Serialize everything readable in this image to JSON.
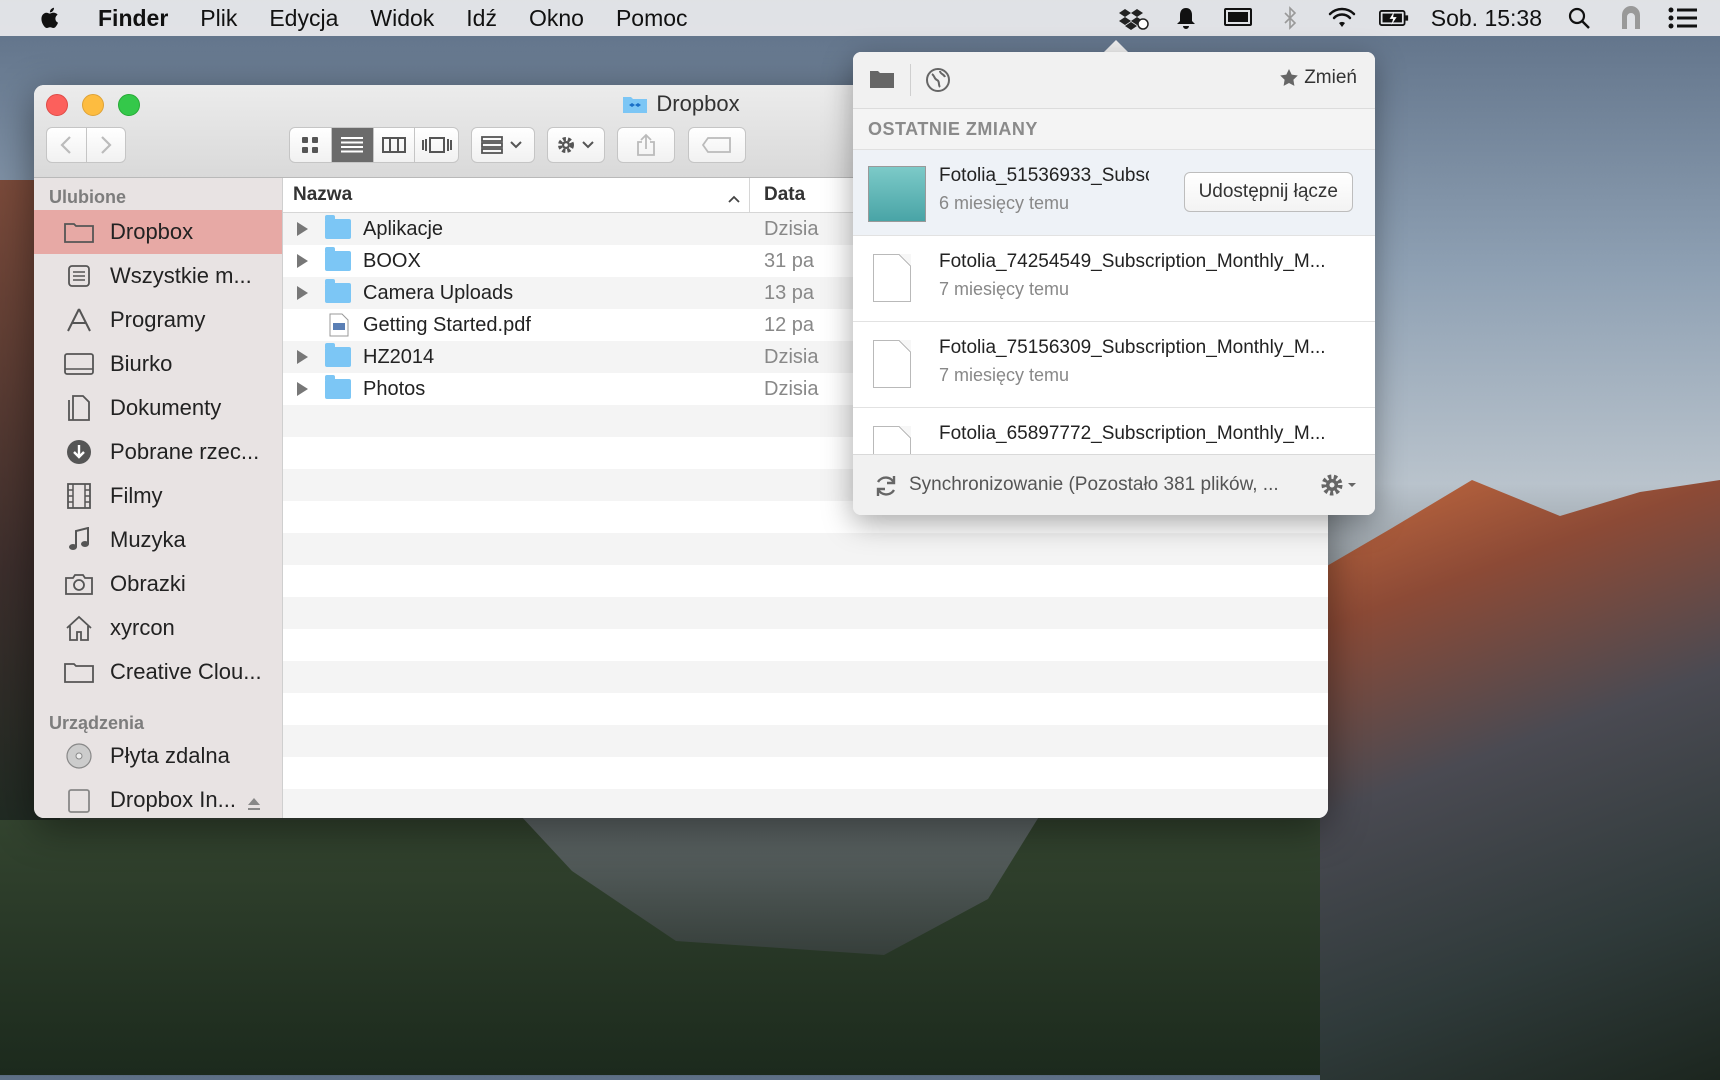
{
  "menubar": {
    "app": "Finder",
    "items": [
      "Plik",
      "Edycja",
      "Widok",
      "Idź",
      "Okno",
      "Pomoc"
    ],
    "clock": "Sob. 15:38"
  },
  "finder": {
    "title": "Dropbox",
    "sidebar": {
      "favorites_header": "Ulubione",
      "favorites": [
        {
          "label": "Dropbox",
          "icon": "folder-icon"
        },
        {
          "label": "Wszystkie m...",
          "icon": "all-files-icon"
        },
        {
          "label": "Programy",
          "icon": "applications-icon"
        },
        {
          "label": "Biurko",
          "icon": "desktop-icon"
        },
        {
          "label": "Dokumenty",
          "icon": "documents-icon"
        },
        {
          "label": "Pobrane rzec...",
          "icon": "downloads-icon"
        },
        {
          "label": "Filmy",
          "icon": "movies-icon"
        },
        {
          "label": "Muzyka",
          "icon": "music-icon"
        },
        {
          "label": "Obrazki",
          "icon": "camera-icon"
        },
        {
          "label": "xyrcon",
          "icon": "home-icon"
        },
        {
          "label": "Creative Clou...",
          "icon": "folder-icon"
        }
      ],
      "devices_header": "Urządzenia",
      "devices": [
        {
          "label": "Płyta zdalna",
          "icon": "disc-icon"
        },
        {
          "label": "Dropbox In...",
          "icon": "disk-icon"
        }
      ]
    },
    "columns": {
      "name": "Nazwa",
      "date": "Data"
    },
    "rows": [
      {
        "name": "Aplikacje",
        "date": "Dzisia",
        "kind": "folder"
      },
      {
        "name": "BOOX",
        "date": "31 pa",
        "kind": "folder"
      },
      {
        "name": "Camera Uploads",
        "date": "13 pa",
        "kind": "folder"
      },
      {
        "name": "Getting Started.pdf",
        "date": "12 pa",
        "kind": "pdf"
      },
      {
        "name": "HZ2014",
        "date": "Dzisia",
        "kind": "folder"
      },
      {
        "name": "Photos",
        "date": "Dzisia",
        "kind": "folder"
      }
    ]
  },
  "dropbox": {
    "change_label": "Zmień",
    "section": "OSTATNIE ZMIANY",
    "items": [
      {
        "name": "Fotolia_51536933_Subsc",
        "time": "6 miesięcy temu"
      },
      {
        "name": "Fotolia_74254549_Subscription_Monthly_M...",
        "time": "7 miesięcy temu"
      },
      {
        "name": "Fotolia_75156309_Subscription_Monthly_M...",
        "time": "7 miesięcy temu"
      },
      {
        "name": "Fotolia_65897772_Subscription_Monthly_M...",
        "time": ""
      }
    ],
    "share_label": "Udostępnij łącze",
    "status": "Synchronizowanie (Pozostało 381 plików, ..."
  }
}
